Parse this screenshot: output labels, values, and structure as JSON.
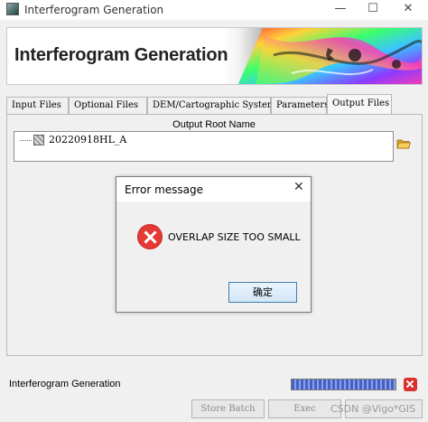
{
  "window": {
    "title": "Interferogram Generation",
    "controls": {
      "minimize": "—",
      "maximize": "☐",
      "close": "✕"
    }
  },
  "banner": {
    "title": "Interferogram Generation",
    "image": "interferogram-fringe-graphic"
  },
  "tabs": [
    {
      "label": "Input Files",
      "active": false
    },
    {
      "label": "Optional Files",
      "active": false
    },
    {
      "label": "DEM/Cartographic System",
      "active": false
    },
    {
      "label": "Parameters",
      "active": false
    },
    {
      "label": "Output Files",
      "active": true
    }
  ],
  "output": {
    "root_label": "Output Root Name",
    "tree_item": "20220918HL_A",
    "folder_icon": "folder-open-icon"
  },
  "dialog": {
    "title": "Error message",
    "close": "✕",
    "message": "OVERLAP SIZE TOO SMALL",
    "icon": "error-icon",
    "ok_label": "确定"
  },
  "footer": {
    "status_label": "Interferogram Generation",
    "progress_fraction": 1.0,
    "store_batch_label": "Store Batch",
    "exec_label": "Exec",
    "watermark": "CSDN @Vigo*GIS"
  },
  "colors": {
    "accent": "#3c7fb1",
    "error": "#e53935",
    "progress": "#4561c8"
  }
}
